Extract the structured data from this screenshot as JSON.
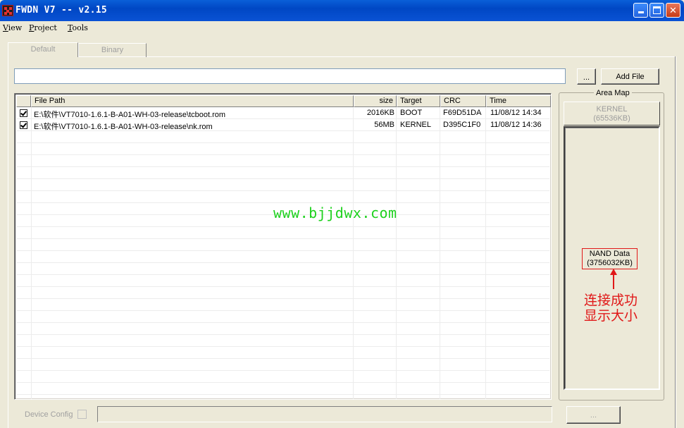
{
  "window": {
    "title": "FWDN V7 -- v2.15"
  },
  "menu": [
    {
      "label": "View",
      "accel": "V",
      "rest": "iew"
    },
    {
      "label": "Project",
      "accel": "P",
      "rest": "roject"
    },
    {
      "label": "Tools",
      "accel": "T",
      "rest": "ools"
    }
  ],
  "tabs": [
    {
      "label": "Default"
    },
    {
      "label": "Binary"
    }
  ],
  "file_input": {
    "value": ""
  },
  "buttons": {
    "browse": "...",
    "add_file": "Add File",
    "device_config_browse": "..."
  },
  "table": {
    "columns": [
      "File Path",
      "size",
      "Target",
      "CRC",
      "Time"
    ],
    "rows": [
      {
        "checked": true,
        "path": "E:\\软件\\VT7010-1.6.1-B-A01-WH-03-release\\tcboot.rom",
        "size": "2016KB",
        "target": "BOOT",
        "crc": "F69D51DA",
        "time": "11/08/12 14:34"
      },
      {
        "checked": true,
        "path": "E:\\软件\\VT7010-1.6.1-B-A01-WH-03-release\\nk.rom",
        "size": "56MB",
        "target": "KERNEL",
        "crc": "D395C1F0",
        "time": "11/08/12 14:36"
      }
    ]
  },
  "watermark": "www.bjjdwx.com",
  "area_map": {
    "title": "Area Map",
    "kernel": {
      "name": "KERNEL",
      "size": "(65536KB)"
    },
    "nand": {
      "name": "NAND Data",
      "size": "(3756032KB)"
    }
  },
  "annotation": {
    "line1": "连接成功",
    "line2": "显示大小"
  },
  "device_config": {
    "label": "Device Config",
    "checked": false,
    "value": ""
  },
  "colors": {
    "titlebar": "#0047c4",
    "annotation": "#e01818",
    "watermark": "#1ed11e"
  }
}
